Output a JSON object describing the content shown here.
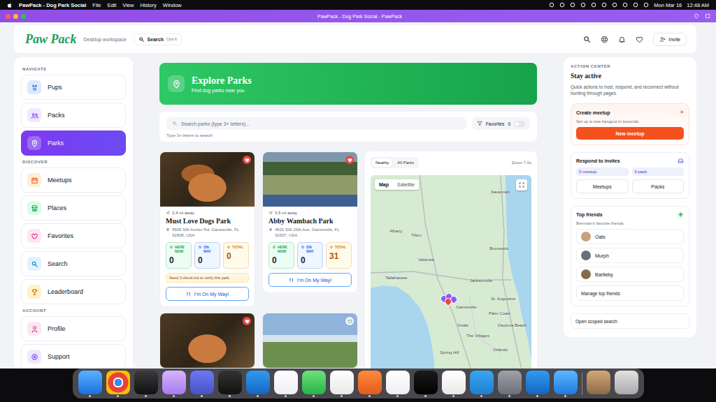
{
  "menubar": {
    "app": "PawPack - Dog Park Social",
    "menus": [
      "File",
      "Edit",
      "View",
      "History",
      "Window"
    ],
    "date": "Mon Mar 16",
    "time": "12:48 AM"
  },
  "window": {
    "title": "PawPack - Dog Park Social - PawPack"
  },
  "header": {
    "logo": "Paw Pack",
    "workspace": "Desktop workspace",
    "search": {
      "label": "Search",
      "shortcut": "Cmd K"
    },
    "invite": "Invite"
  },
  "sidebar": {
    "sections": [
      {
        "title": "NAVIGATE",
        "items": [
          {
            "label": "Pups",
            "selected": false
          },
          {
            "label": "Packs",
            "selected": false
          },
          {
            "label": "Parks",
            "selected": true
          }
        ]
      },
      {
        "title": "DISCOVER",
        "items": [
          {
            "label": "Meetups",
            "selected": false
          },
          {
            "label": "Places",
            "selected": false
          },
          {
            "label": "Favorites",
            "selected": false
          },
          {
            "label": "Search",
            "selected": false
          },
          {
            "label": "Leaderboard",
            "selected": false
          }
        ]
      },
      {
        "title": "ACCOUNT",
        "items": [
          {
            "label": "Profile",
            "selected": false
          },
          {
            "label": "Support",
            "selected": false
          }
        ]
      }
    ]
  },
  "banner": {
    "title": "Explore Parks",
    "subtitle": "Find dog parks near you"
  },
  "park_search": {
    "placeholder": "Search parks (type 3+ letters)...",
    "hint": "Type 3+ letters to search",
    "favorites": {
      "label": "Favorites",
      "count": "6",
      "on": false
    }
  },
  "cards": [
    {
      "distance": "2.4 mi away",
      "name": "Must Love Dogs Park",
      "address": "5505 SW Archer Rd, Gainesville, FL 32608, USA",
      "favorite": true,
      "stats": [
        {
          "label": "HERE NOW",
          "value": "0",
          "color": "#16a34a"
        },
        {
          "label": "ON WAY",
          "value": "0",
          "color": "#2563eb"
        },
        {
          "label": "TOTAL",
          "value": "0",
          "color": "#d97706"
        }
      ],
      "note": "Need 3 check-ins to verify this park.",
      "button": "I'm On My Way!"
    },
    {
      "distance": "3.5 mi away",
      "name": "Abby Wambach Park",
      "address": "4501 SW 20th Ave, Gainesville, FL 32607, USA",
      "favorite": true,
      "stats": [
        {
          "label": "HERE NOW",
          "value": "0",
          "color": "#16a34a"
        },
        {
          "label": "ON WAY",
          "value": "0",
          "color": "#2563eb"
        },
        {
          "label": "TOTAL",
          "value": "31",
          "color": "#d97706"
        }
      ],
      "button": "I'm On My Way!"
    }
  ],
  "cards_below": [
    {
      "favorite": true
    },
    {
      "favorite": false
    }
  ],
  "map": {
    "tabs": [
      {
        "label": "Nearby",
        "selected": true
      },
      {
        "label": "All Parks",
        "selected": false
      }
    ],
    "zoom": "Zoom 7.0x",
    "types": [
      {
        "label": "Map",
        "selected": true
      },
      {
        "label": "Satellite",
        "selected": false
      }
    ],
    "places": [
      "Savannah",
      "Albany",
      "Tifton",
      "Valdosta",
      "Tallahassee",
      "Brunswick",
      "Jacksonville",
      "St. Augustine",
      "Gainesville",
      "Palm Coast",
      "Ocala",
      "Daytona Beach",
      "The Villages",
      "Orlando",
      "Spring Hill"
    ],
    "pins": [
      {
        "selected": false
      },
      {
        "selected": false
      },
      {
        "selected": false
      },
      {
        "selected": true
      }
    ]
  },
  "action_center": {
    "eyebrow": "ACTION CENTER",
    "title": "Stay active",
    "description": "Quick actions to host, respond, and reconnect without hunting through pages.",
    "create": {
      "title": "Create meetup",
      "plus": "+",
      "subtitle": "Set up a new hangout in seconds.",
      "button": "New meetup"
    },
    "invites": {
      "title": "Respond to invites",
      "chips": [
        "0 meetup",
        "0 pack"
      ],
      "buttons": [
        "Meetups",
        "Packs"
      ]
    },
    "friends": {
      "title": "Top friends",
      "subtitle": "Brennan's favorite friends.",
      "items": [
        {
          "name": "Oats"
        },
        {
          "name": "Murph"
        },
        {
          "name": "Bartleby"
        }
      ],
      "manage": "Manage top friends"
    },
    "scoped": "Open scoped search"
  },
  "dock": {
    "apps": [
      {
        "running": true
      },
      {
        "running": true
      },
      {
        "running": true
      },
      {
        "running": true
      },
      {
        "running": true
      },
      {
        "running": true
      },
      {
        "running": true
      },
      {
        "running": true
      },
      {
        "running": true
      },
      {
        "running": true
      },
      {
        "running": true
      },
      {
        "running": true
      },
      {
        "running": true
      },
      {
        "running": true
      },
      {
        "running": true
      },
      {
        "running": true
      },
      {
        "running": true
      },
      {
        "running": true
      },
      {
        "running": false
      },
      {
        "running": false
      }
    ]
  }
}
